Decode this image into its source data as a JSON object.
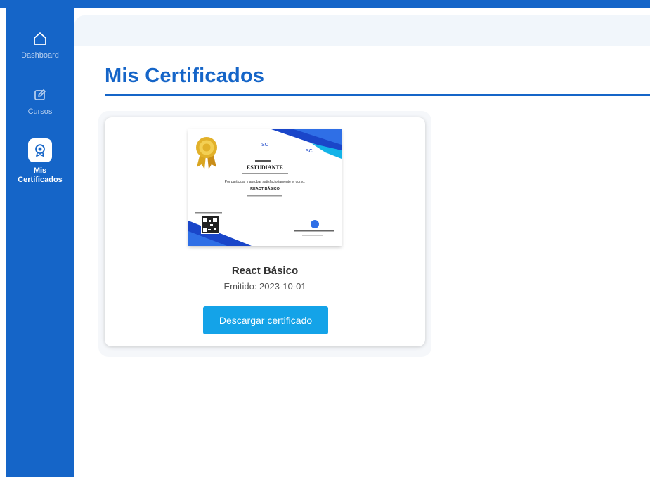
{
  "sidebar": {
    "items": [
      {
        "label": "Dashboard",
        "icon": "home-icon"
      },
      {
        "label": "Cursos",
        "icon": "edit-icon"
      },
      {
        "label_line1": "Mis",
        "label_line2": "Certificados",
        "icon": "badge-icon",
        "active": true
      }
    ]
  },
  "page": {
    "title": "Mis Certificados"
  },
  "certificates": [
    {
      "name": "React Básico",
      "issued": "Emitido: 2023-10-01",
      "download_label": "Descargar certificado",
      "preview": {
        "recipient": "ESTUDIANTE",
        "intro": "Por participar y aprobar satisfactoriamente el curso:",
        "course": "REACT BÁSICO"
      }
    }
  ],
  "colors": {
    "brand": "#1565c8",
    "button": "#14a3e8",
    "gold": "#d9a520"
  }
}
